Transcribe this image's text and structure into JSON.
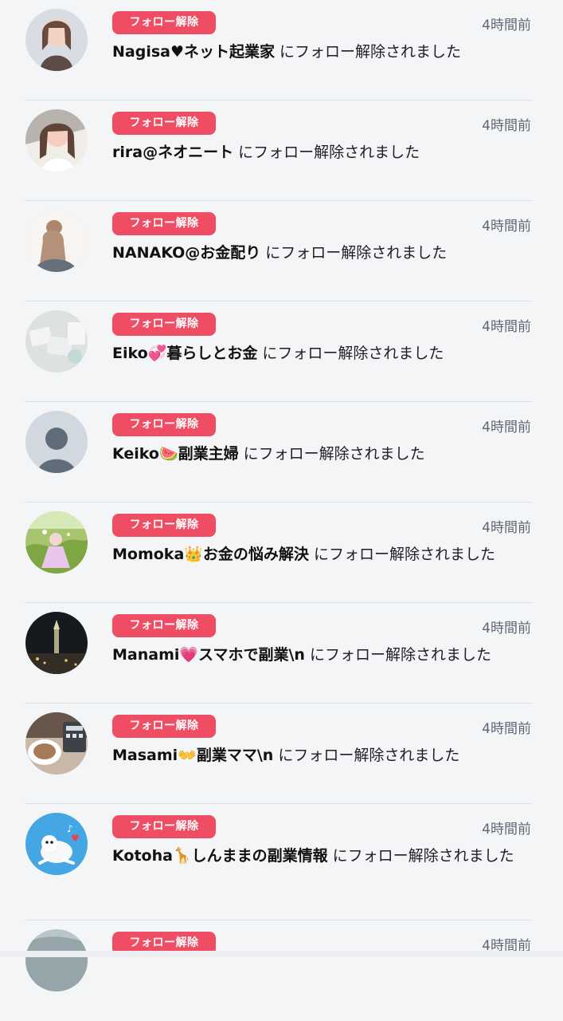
{
  "notifications": [
    {
      "badge": "フォロー解除",
      "name": "Nagisa♥ネット起業家",
      "suffix": " にフォロー解除されました",
      "time": "4時間前"
    },
    {
      "badge": "フォロー解除",
      "name": "rira@ネオニート",
      "suffix": " にフォロー解除されました",
      "time": "4時間前"
    },
    {
      "badge": "フォロー解除",
      "name": "NANAKO@お金配り",
      "suffix": " にフォロー解除されました",
      "time": "4時間前"
    },
    {
      "badge": "フォロー解除",
      "name": "Eiko💞暮らしとお金",
      "suffix": " にフォロー解除されました",
      "time": "4時間前"
    },
    {
      "badge": "フォロー解除",
      "name": "Keiko🍉副業主婦",
      "suffix": " にフォロー解除されました",
      "time": "4時間前"
    },
    {
      "badge": "フォロー解除",
      "name": "Momoka👑お金の悩み解決",
      "suffix": " にフォロー解除されました",
      "time": "4時間前"
    },
    {
      "badge": "フォロー解除",
      "name": "Manami💗スマホで副業\\n",
      "suffix": " にフォロー解除されました",
      "time": "4時間前"
    },
    {
      "badge": "フォロー解除",
      "name": "Masami👐副業ママ\\n",
      "suffix": " にフォロー解除されました",
      "time": "4時間前"
    },
    {
      "badge": "フォロー解除",
      "name": "Kotoha🦒しんままの副業情報",
      "suffix": " にフォロー解除されました",
      "time": "4時間前"
    },
    {
      "badge": "フォロー解除",
      "name": "",
      "suffix": "",
      "time": "4時間前"
    }
  ]
}
